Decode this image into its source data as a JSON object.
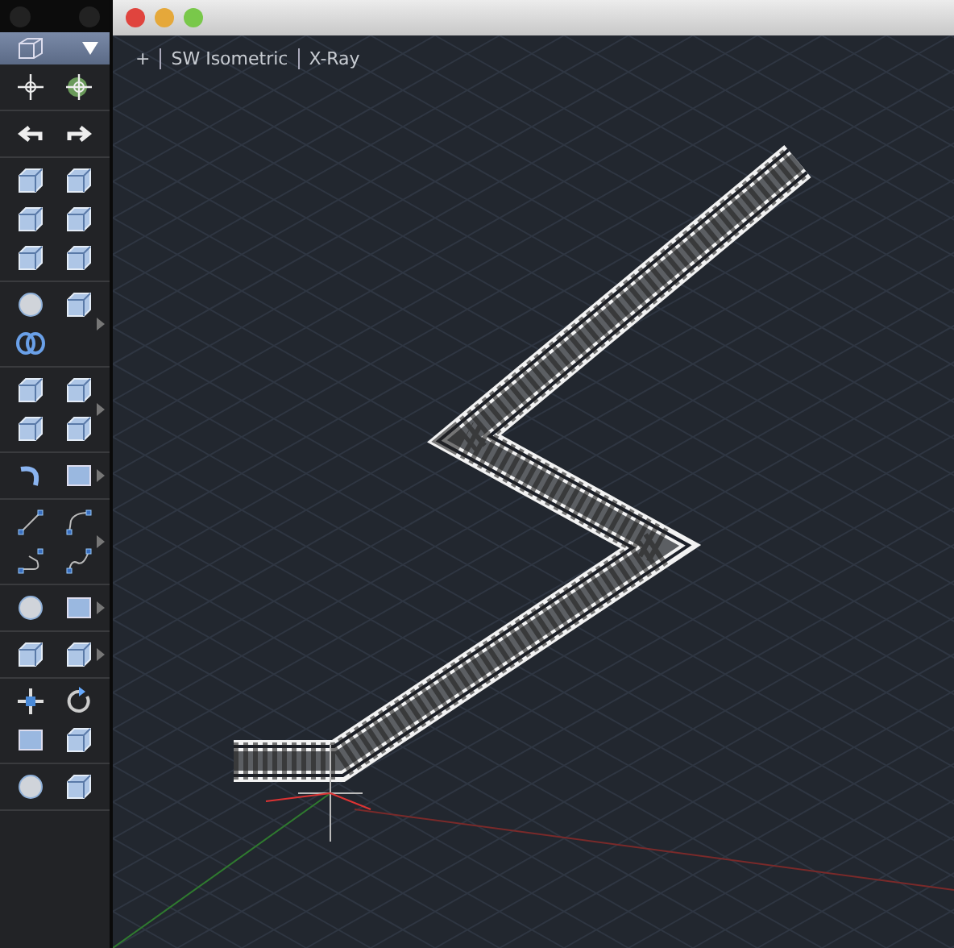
{
  "viewport": {
    "view_controls": [
      "+",
      "SW Isometric",
      "X-Ray"
    ]
  }
}
